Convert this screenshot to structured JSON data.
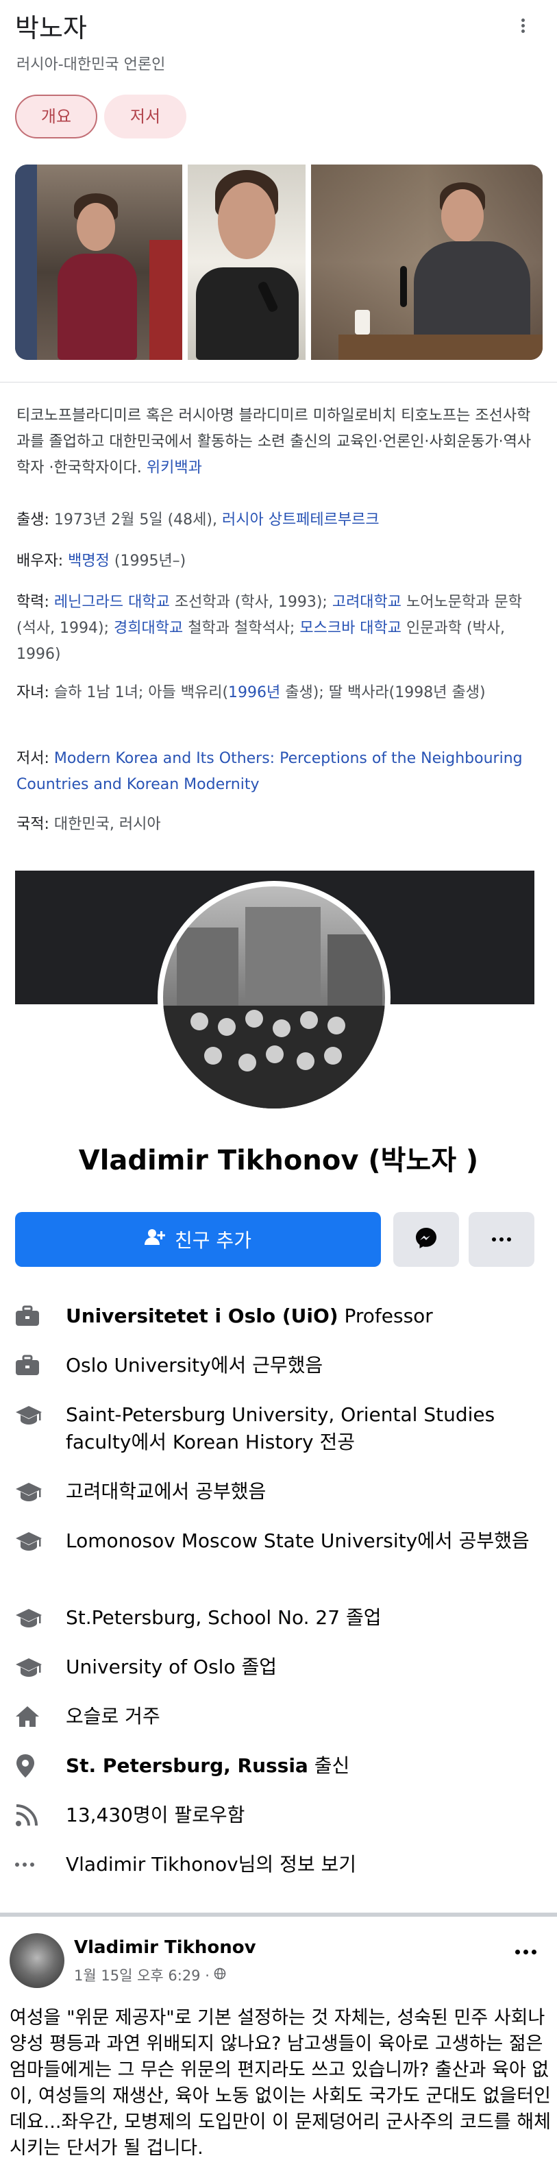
{
  "knowledge_panel": {
    "title": "박노자",
    "subtitle": "러시아-대한민국 언론인",
    "tabs": [
      {
        "label": "개요"
      },
      {
        "label": "저서"
      }
    ],
    "description": "티코노프블라디미르 혹은 러시아명 블라디미르 미하일로비치 티호노프는 조선사학과를 졸업하고 대한민국에서 활동하는 소련 출신의 교육인·언론인·사회운동가·역사학자 ·한국학자이다.",
    "description_source": "위키백과",
    "facts": {
      "born_label": "출생:",
      "born_value": "1973년 2월 5일 (48세),",
      "born_place": "러시아 상트페테르부르크",
      "spouse_label": "배우자:",
      "spouse_link": "백명정",
      "spouse_years": "(1995년–)",
      "edu_label": "학력:",
      "edu_1_link": "레닌그라드 대학교",
      "edu_1_text": "조선학과 (학사, 1993);",
      "edu_2_link": "고려대학교",
      "edu_2_text": "노어노문학과 문학 (석사, 1994);",
      "edu_3_link": "경희대학교",
      "edu_3_text": "철학과 철학석사;",
      "edu_4_link": "모스크바 대학교",
      "edu_4_text": "인문과학 (박사, 1996)",
      "children_label": "자녀:",
      "children_pre": "슬하 1남 1녀; 아들 백유리(",
      "children_link": "1996년",
      "children_post": "출생); 딸 백사라(1998년 출생)",
      "books_label": "저서:",
      "books_link": "Modern Korea and Its Others: Perceptions of the Neighbouring Countries and Korean Modernity",
      "nationality_label": "국적:",
      "nationality_value": "대한민국, 러시아"
    }
  },
  "profile": {
    "name": "Vladimir Tikhonov (박노자 )",
    "add_friend_label": "친구 추가",
    "info": [
      {
        "icon": "briefcase-icon",
        "bold": "Universitetet i Oslo (UiO)",
        "text": " Professor"
      },
      {
        "icon": "briefcase-icon",
        "bold": "",
        "text": "Oslo University에서 근무했음"
      },
      {
        "icon": "graduation-cap-icon",
        "bold": "",
        "text": "Saint-Petersburg University, Oriental Studies faculty에서 Korean History 전공"
      },
      {
        "icon": "graduation-cap-icon",
        "bold": "",
        "text": "고려대학교에서 공부했음"
      },
      {
        "icon": "graduation-cap-icon",
        "bold": "",
        "text": "Lomonosov Moscow State University에서 공부했음"
      },
      {
        "icon": "graduation-cap-icon",
        "bold": "",
        "text": "St.Petersburg, School No. 27 졸업"
      },
      {
        "icon": "graduation-cap-icon",
        "bold": "",
        "text": "University of Oslo 졸업"
      },
      {
        "icon": "home-icon",
        "bold": "",
        "text": "오슬로 거주"
      },
      {
        "icon": "location-pin-icon",
        "bold": "St. Petersburg, Russia",
        "text": " 출신"
      },
      {
        "icon": "rss-icon",
        "bold": "",
        "text": "13,430명이 팔로우함"
      },
      {
        "icon": "more-dots-icon",
        "bold": "",
        "text": "Vladimir Tikhonov님의 정보 보기"
      }
    ]
  },
  "post": {
    "author": "Vladimir Tikhonov",
    "time": "1월 15일 오후 6:29 ·",
    "body": "여성을 \"위문 제공자\"로 기본 설정하는 것 자체는, 성숙된 민주 사회나 양성 평등과 과연 위배되지 않나요? 남고생들이 육아로 고생하는 젊은 엄마들에게는 그 무슨 위문의 편지라도 쓰고 있습니까? 출산과 육아 없이, 여성들의 재생산, 육아 노동 없이는 사회도 국가도 군대도 없을터인데요...좌우간, 모병제의 도입만이 이 문제덩어리 군사주의 코드를 해체시키는 단서가 될 겁니다."
  }
}
